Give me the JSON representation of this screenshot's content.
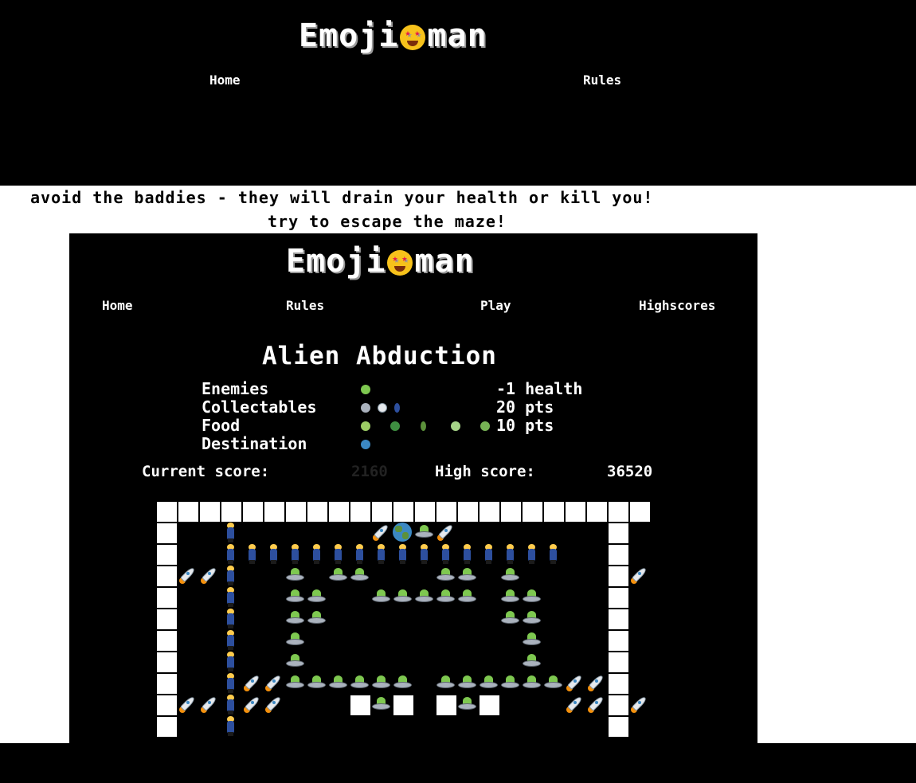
{
  "outer": {
    "logo_left": "Emoji",
    "logo_right": "man",
    "nav": [
      "Home",
      "Rules"
    ]
  },
  "rules_text": [
    "avoid the baddies - they will drain your health or kill you!",
    "try to escape the maze!"
  ],
  "game": {
    "logo_left": "Emoji",
    "logo_right": "man",
    "nav": [
      "Home",
      "Rules",
      "Play",
      "Highscores"
    ],
    "level_title": "Alien Abduction",
    "legend": [
      {
        "label": "Enemies",
        "icons": [
          "alien-icon"
        ],
        "value": "-1 health"
      },
      {
        "label": "Collectables",
        "icons": [
          "ufo-icon",
          "rocket-icon",
          "astronaut-icon"
        ],
        "value": "20 pts"
      },
      {
        "label": "Food",
        "icons": [
          "avocado-icon",
          "broccoli-icon",
          "cucumber-icon",
          "green-apple-icon",
          "kiwi-icon"
        ],
        "value": "10 pts"
      },
      {
        "label": "Destination",
        "icons": [
          "earth-icon"
        ],
        "value": ""
      }
    ],
    "current_score_label": "Current score:",
    "current_score": "2160",
    "high_score_label": "High score:",
    "high_score": "36520"
  },
  "colors": {
    "background": "#000000",
    "wall": "#ffffff",
    "text": "#ffffff"
  }
}
